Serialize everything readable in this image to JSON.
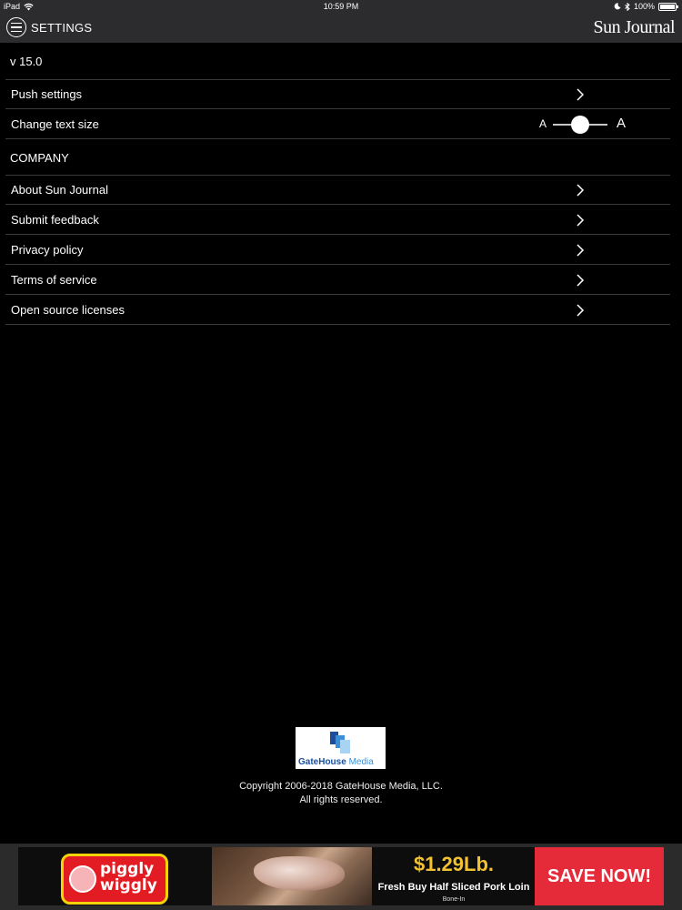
{
  "status_bar": {
    "device": "iPad",
    "time": "10:59 PM",
    "battery": "100%"
  },
  "header": {
    "title": "SETTINGS",
    "logo": "Sun Journal"
  },
  "version": "v 15.0",
  "settings": {
    "push_settings": "Push settings",
    "change_text_size": "Change text size",
    "text_size_small": "A",
    "text_size_large": "A",
    "text_size_level": 0.5
  },
  "company": {
    "title": "COMPANY",
    "items": [
      {
        "label": "About Sun Journal"
      },
      {
        "label": "Submit feedback"
      },
      {
        "label": "Privacy policy"
      },
      {
        "label": "Terms of service"
      },
      {
        "label": "Open source licenses"
      }
    ]
  },
  "footer": {
    "logo_text_1": "GateHouse",
    "logo_text_2": "Media",
    "copyright_line1": "Copyright 2006-2018 GateHouse Media, LLC.",
    "copyright_line2": "All rights reserved."
  },
  "ad": {
    "brand": "piggly wiggly",
    "price": "$1.29Lb.",
    "description": "Fresh Buy Half Sliced Pork Loin",
    "subdescription": "Bone-In",
    "cta": "SAVE NOW!"
  },
  "colors": {
    "background": "#000000",
    "header": "#2c2c2e",
    "divider": "#3a3a3a",
    "ad_red": "#e52b39",
    "ad_price": "#f2c230"
  }
}
